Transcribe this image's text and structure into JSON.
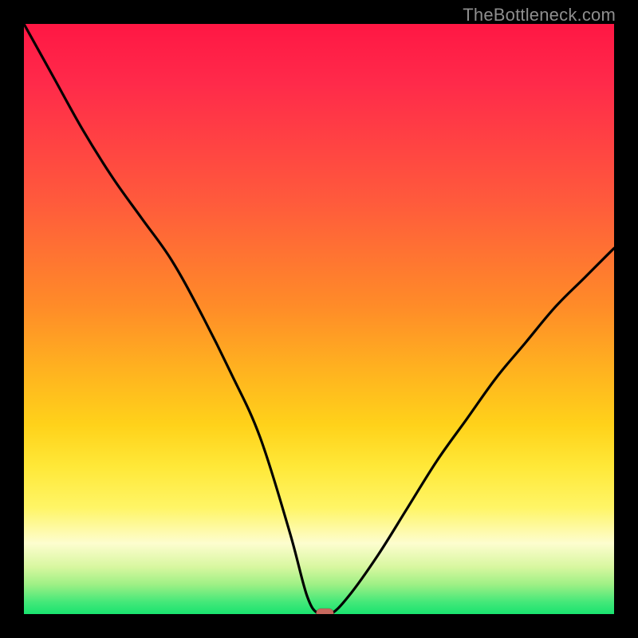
{
  "credit": "TheBottleneck.com",
  "colors": {
    "bg": "#000000",
    "credit_text": "#8e8e8e",
    "curve": "#000000",
    "marker_fill": "#c7695e",
    "gradient_stops": [
      "#ff1744",
      "#ff5a3c",
      "#ff8c28",
      "#ffd21a",
      "#fff566",
      "#fdfdcf",
      "#43e879",
      "#19e36f"
    ]
  },
  "chart_data": {
    "type": "line",
    "title": "",
    "xlabel": "",
    "ylabel": "",
    "xlim": [
      0,
      100
    ],
    "ylim": [
      0,
      100
    ],
    "grid": false,
    "legend": false,
    "series": [
      {
        "name": "bottleneck-curve",
        "x": [
          0,
          5,
          10,
          15,
          20,
          25,
          30,
          35,
          40,
          45,
          48,
          50,
          52,
          55,
          60,
          65,
          70,
          75,
          80,
          85,
          90,
          95,
          100
        ],
        "y": [
          100,
          91,
          82,
          74,
          67,
          60,
          51,
          41,
          30,
          14,
          3,
          0,
          0,
          3,
          10,
          18,
          26,
          33,
          40,
          46,
          52,
          57,
          62
        ]
      }
    ],
    "marker": {
      "x": 51,
      "y": 0,
      "shape": "rounded-rect"
    },
    "notes": "Heat-map style vertical gradient background; the black curve shows bottleneck percentage reaching 0 near x≈50."
  }
}
